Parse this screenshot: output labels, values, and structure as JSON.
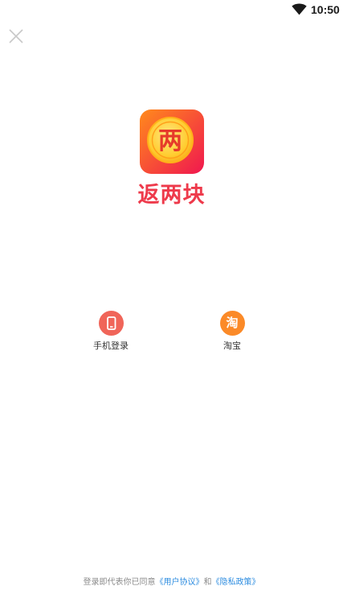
{
  "status_bar": {
    "time": "10:50",
    "wifi_icon": "wifi-icon"
  },
  "close_icon": "close-icon",
  "app": {
    "logo_char": "两",
    "name": "返两块",
    "brand_color": "#ee3a4b",
    "logo_gradient": [
      "#ff7a1a",
      "#f2234f"
    ]
  },
  "login_options": [
    {
      "label": "手机登录",
      "icon": "phone-icon",
      "color": "#f06559"
    },
    {
      "label": "淘宝",
      "icon": "taobao-icon",
      "glyph": "淘",
      "color": "#fb8a28"
    }
  ],
  "agreement": {
    "prefix": "登录即代表你已同意",
    "user_agreement": "《用户协议》",
    "and": "和",
    "privacy_policy": "《隐私政策》",
    "link_color": "#2e8de0"
  }
}
